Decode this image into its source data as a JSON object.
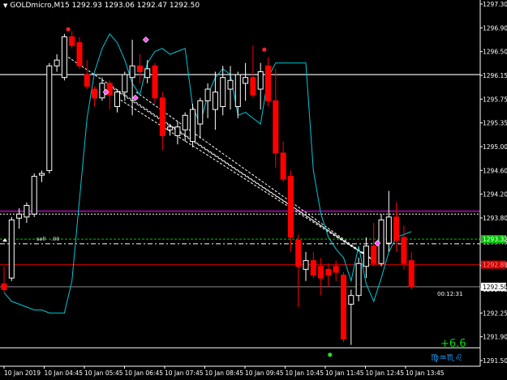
{
  "window": {
    "title": "GOLDmicro,M15",
    "ohlc": [
      "1292.93",
      "1293.06",
      "1292.47",
      "1292.50"
    ]
  },
  "price_axis": {
    "labels": [
      "1297.30",
      "1296.90",
      "1296.50",
      "1296.15",
      "1295.75",
      "1295.35",
      "1295.00",
      "1294.60",
      "1294.20",
      "1293.80",
      "1293.45",
      "1293.05",
      "1292.65",
      "1292.25",
      "1291.90",
      "1291.50"
    ],
    "badges": {
      "green": "1293.32",
      "red": "1292.88",
      "white": "1292.50"
    }
  },
  "time_axis": {
    "labels": [
      "10 Jan 2019",
      "10 Jan 04:45",
      "10 Jan 05:45",
      "10 Jan 06:45",
      "10 Jan 07:45",
      "10 Jan 08:45",
      "10 Jan 09:45",
      "10 Jan 10:45",
      "10 Jan 11:45",
      "10 Jan 12:45",
      "10 Jan 13:45"
    ]
  },
  "annotations": {
    "sell_label": "sell",
    "sell_value": ".00",
    "timer": "00:12:31",
    "profit": "+6.6",
    "brand_glyphs": "♍♒♏♌"
  },
  "colors": {
    "background": "#000000",
    "bull_body": "#000000",
    "bull_border": "#ffffff",
    "bear_body": "#ff0000",
    "indicator_line": "#00c8d8",
    "magenta_line": "#c000c0",
    "green_dashed": "#00c000",
    "red_level": "#d00000",
    "profit_text": "#00e000",
    "brand_text": "#1aa0ff",
    "badge_green": "#00c000",
    "badge_red": "#d00000"
  },
  "chart_data": {
    "type": "candlestick",
    "symbol": "GOLDmicro",
    "timeframe": "M15",
    "ylim": [
      1291.3,
      1297.35
    ],
    "horizontal_levels": [
      {
        "role": "white_solid",
        "value": 1296.15
      },
      {
        "role": "magenta",
        "value": 1293.8
      },
      {
        "role": "white_dashed",
        "value": 1293.75
      },
      {
        "role": "green_dashed",
        "value": 1293.32
      },
      {
        "role": "white_dashdot",
        "value": 1293.24
      },
      {
        "role": "red_solid",
        "value": 1292.88
      },
      {
        "role": "white_last",
        "value": 1292.5
      },
      {
        "role": "white_bottom",
        "value": 1291.45
      }
    ],
    "candles": [
      {
        "o": 1292.55,
        "h": 1292.85,
        "l": 1292.4,
        "c": 1292.45
      },
      {
        "o": 1292.65,
        "h": 1293.7,
        "l": 1292.6,
        "c": 1293.65
      },
      {
        "o": 1293.68,
        "h": 1293.85,
        "l": 1293.5,
        "c": 1293.75
      },
      {
        "o": 1293.7,
        "h": 1293.95,
        "l": 1293.6,
        "c": 1293.9
      },
      {
        "o": 1293.75,
        "h": 1294.45,
        "l": 1293.7,
        "c": 1294.4
      },
      {
        "o": 1294.42,
        "h": 1294.5,
        "l": 1294.3,
        "c": 1294.45
      },
      {
        "o": 1294.5,
        "h": 1296.35,
        "l": 1294.45,
        "c": 1296.3
      },
      {
        "o": 1296.3,
        "h": 1296.5,
        "l": 1296.2,
        "c": 1296.4
      },
      {
        "o": 1296.1,
        "h": 1296.85,
        "l": 1296.05,
        "c": 1296.8
      },
      {
        "o": 1296.8,
        "h": 1296.9,
        "l": 1296.6,
        "c": 1296.65
      },
      {
        "o": 1296.7,
        "h": 1296.8,
        "l": 1296.25,
        "c": 1296.3
      },
      {
        "o": 1296.15,
        "h": 1296.4,
        "l": 1295.9,
        "c": 1295.95
      },
      {
        "o": 1295.9,
        "h": 1295.95,
        "l": 1295.6,
        "c": 1295.75
      },
      {
        "o": 1295.75,
        "h": 1296.1,
        "l": 1295.7,
        "c": 1296.0
      },
      {
        "o": 1296.0,
        "h": 1296.05,
        "l": 1295.55,
        "c": 1295.8
      },
      {
        "o": 1295.6,
        "h": 1295.9,
        "l": 1295.5,
        "c": 1295.85
      },
      {
        "o": 1295.85,
        "h": 1296.2,
        "l": 1295.7,
        "c": 1296.15
      },
      {
        "o": 1296.1,
        "h": 1296.75,
        "l": 1295.45,
        "c": 1296.3
      },
      {
        "o": 1296.3,
        "h": 1296.5,
        "l": 1296.0,
        "c": 1296.2
      },
      {
        "o": 1296.1,
        "h": 1296.4,
        "l": 1296.0,
        "c": 1296.25
      },
      {
        "o": 1296.3,
        "h": 1296.35,
        "l": 1295.65,
        "c": 1295.75
      },
      {
        "o": 1295.75,
        "h": 1295.85,
        "l": 1294.85,
        "c": 1295.1
      },
      {
        "o": 1295.2,
        "h": 1295.3,
        "l": 1295.1,
        "c": 1295.25
      },
      {
        "o": 1295.1,
        "h": 1295.35,
        "l": 1294.95,
        "c": 1295.25
      },
      {
        "o": 1295.2,
        "h": 1295.5,
        "l": 1295.0,
        "c": 1295.45
      },
      {
        "o": 1295.0,
        "h": 1295.65,
        "l": 1294.9,
        "c": 1295.55
      },
      {
        "o": 1295.3,
        "h": 1295.75,
        "l": 1295.05,
        "c": 1295.7
      },
      {
        "o": 1295.7,
        "h": 1296.0,
        "l": 1295.4,
        "c": 1295.9
      },
      {
        "o": 1295.55,
        "h": 1296.2,
        "l": 1295.2,
        "c": 1295.85
      },
      {
        "o": 1295.6,
        "h": 1296.3,
        "l": 1295.45,
        "c": 1296.1
      },
      {
        "o": 1295.9,
        "h": 1296.3,
        "l": 1295.55,
        "c": 1296.05
      },
      {
        "o": 1295.6,
        "h": 1296.2,
        "l": 1295.4,
        "c": 1296.15
      },
      {
        "o": 1296.0,
        "h": 1296.35,
        "l": 1295.7,
        "c": 1296.1
      },
      {
        "o": 1296.1,
        "h": 1296.65,
        "l": 1295.75,
        "c": 1295.8
      },
      {
        "o": 1295.9,
        "h": 1296.35,
        "l": 1295.55,
        "c": 1296.2
      },
      {
        "o": 1296.3,
        "h": 1296.45,
        "l": 1295.6,
        "c": 1295.7
      },
      {
        "o": 1295.7,
        "h": 1296.25,
        "l": 1294.55,
        "c": 1294.8
      },
      {
        "o": 1294.8,
        "h": 1295.0,
        "l": 1294.3,
        "c": 1294.35
      },
      {
        "o": 1294.4,
        "h": 1294.5,
        "l": 1293.1,
        "c": 1293.35
      },
      {
        "o": 1293.3,
        "h": 1293.4,
        "l": 1292.15,
        "c": 1292.85
      },
      {
        "o": 1292.8,
        "h": 1293.1,
        "l": 1292.6,
        "c": 1292.95
      },
      {
        "o": 1292.95,
        "h": 1293.1,
        "l": 1292.65,
        "c": 1292.7
      },
      {
        "o": 1292.85,
        "h": 1293.0,
        "l": 1292.35,
        "c": 1292.65
      },
      {
        "o": 1292.8,
        "h": 1292.9,
        "l": 1292.5,
        "c": 1292.7
      },
      {
        "o": 1292.85,
        "h": 1292.95,
        "l": 1292.6,
        "c": 1292.75
      },
      {
        "o": 1292.7,
        "h": 1292.75,
        "l": 1291.55,
        "c": 1291.6
      },
      {
        "o": 1292.2,
        "h": 1292.45,
        "l": 1291.5,
        "c": 1292.35
      },
      {
        "o": 1292.35,
        "h": 1293.0,
        "l": 1292.25,
        "c": 1292.9
      },
      {
        "o": 1292.85,
        "h": 1293.35,
        "l": 1292.65,
        "c": 1293.2
      },
      {
        "o": 1293.2,
        "h": 1293.6,
        "l": 1292.85,
        "c": 1292.9
      },
      {
        "o": 1292.9,
        "h": 1293.75,
        "l": 1292.85,
        "c": 1293.65
      },
      {
        "o": 1293.25,
        "h": 1294.15,
        "l": 1293.1,
        "c": 1293.7
      },
      {
        "o": 1293.7,
        "h": 1293.95,
        "l": 1293.1,
        "c": 1293.3
      },
      {
        "o": 1293.35,
        "h": 1293.55,
        "l": 1292.8,
        "c": 1292.9
      },
      {
        "o": 1292.95,
        "h": 1293.1,
        "l": 1292.45,
        "c": 1292.5
      }
    ],
    "indicator": {
      "name": "",
      "values": [
        1292.4,
        1292.25,
        1292.2,
        1292.15,
        1292.1,
        1292.1,
        1292.05,
        1292.05,
        1292.05,
        1292.6,
        1294.0,
        1295.4,
        1296.2,
        1296.6,
        1296.85,
        1296.7,
        1296.4,
        1296.0,
        1295.8,
        1296.35,
        1296.55,
        1296.6,
        1296.5,
        1296.55,
        1296.6,
        1295.6,
        1295.3,
        1295.8,
        1296.1,
        1296.25,
        1296.15,
        1295.45,
        1295.5,
        1295.4,
        1295.3,
        1296.1,
        1296.35,
        1296.35,
        1296.35,
        1296.35,
        1296.35,
        1294.5,
        1293.75,
        1293.35,
        1293.15,
        1293.0,
        1292.6,
        1293.2,
        1292.55,
        1292.25,
        1292.65,
        1293.1,
        1293.35,
        1293.4,
        1293.45
      ]
    },
    "trendlines": [
      {
        "style": "dashed",
        "from": {
          "i": 8.5,
          "p": 1296.45
        },
        "to": {
          "i": 49,
          "p": 1292.95
        }
      },
      {
        "style": "dashed",
        "from": {
          "i": 14,
          "p": 1295.95
        },
        "to": {
          "i": 49,
          "p": 1292.95
        }
      },
      {
        "style": "dashed",
        "from": {
          "i": 15,
          "p": 1295.75
        },
        "to": {
          "i": 49,
          "p": 1292.95
        }
      },
      {
        "style": "dashed",
        "from": {
          "i": 17.5,
          "p": 1295.85
        },
        "to": {
          "i": 49,
          "p": 1292.95
        }
      },
      {
        "style": "solid",
        "from": {
          "i": 47.5,
          "p": 1293.1
        },
        "to": {
          "i": 49,
          "p": 1292.95
        }
      }
    ],
    "markers": [
      {
        "color": "#ff2020",
        "shape": "dot",
        "i": 8.5,
        "p": 1296.93
      },
      {
        "color": "#ff2020",
        "shape": "dot",
        "i": 34.5,
        "p": 1296.58
      },
      {
        "color": "#ff50ff",
        "shape": "diamond",
        "i": 13.5,
        "p": 1295.85
      },
      {
        "color": "#ff50ff",
        "shape": "diamond",
        "i": 17.4,
        "p": 1295.75
      },
      {
        "color": "#ff50ff",
        "shape": "diamond",
        "i": 18.8,
        "p": 1296.75
      },
      {
        "color": "#ff50ff",
        "shape": "diamond",
        "i": 49.5,
        "p": 1293.25
      },
      {
        "color": "#20e020",
        "shape": "dot",
        "i": 43.2,
        "p": 1291.33
      }
    ]
  }
}
